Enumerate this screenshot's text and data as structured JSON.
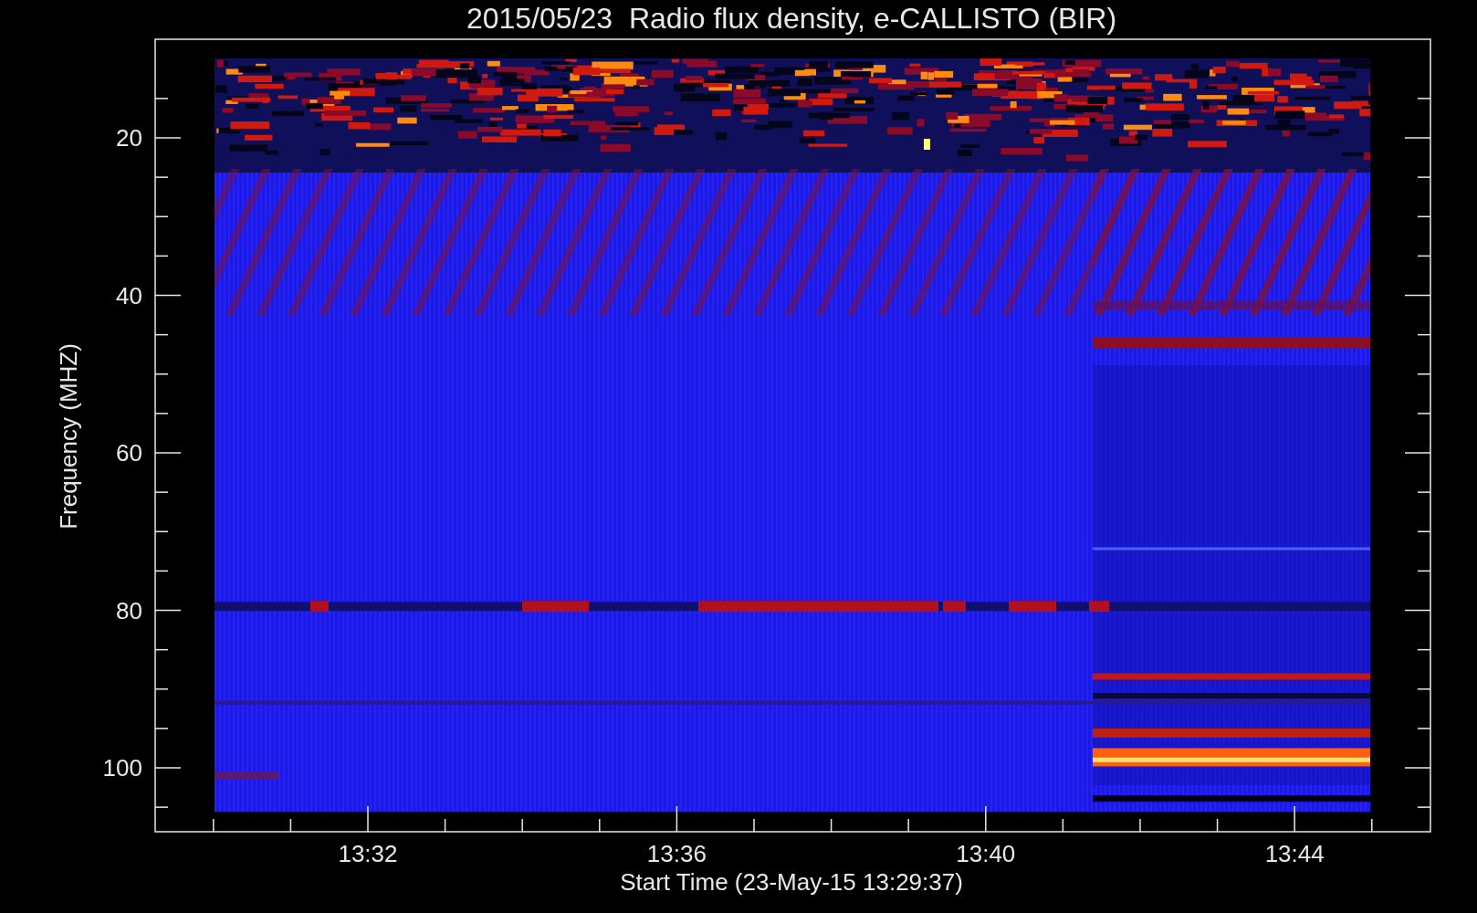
{
  "title": "2015/05/23  Radio flux density, e-CALLISTO (BIR)",
  "y_axis": {
    "label": "Frequency (MHZ)",
    "ticks": [
      "20",
      "40",
      "60",
      "80",
      "100"
    ]
  },
  "x_axis": {
    "label": "Start Time (23-May-15 13:29:37)",
    "ticks": [
      "13:32",
      "13:36",
      "13:40",
      "13:44"
    ]
  }
}
